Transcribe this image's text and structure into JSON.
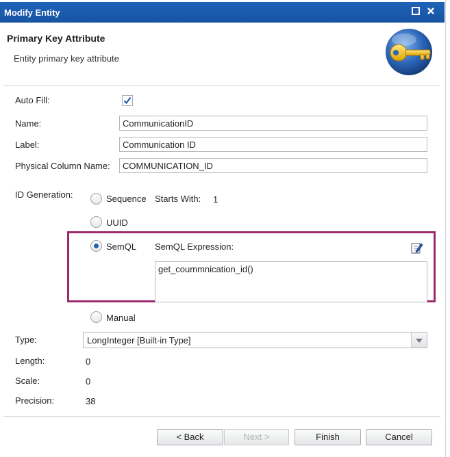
{
  "window": {
    "title": "Modify Entity",
    "maximize_icon": "maximize-icon",
    "close_icon": "close-icon"
  },
  "header": {
    "title": "Primary Key Attribute",
    "subtitle": "Entity primary key attribute",
    "icon": "key-icon"
  },
  "form": {
    "auto_fill": {
      "label": "Auto Fill:",
      "checked": true
    },
    "name": {
      "label": "Name:",
      "value": "CommunicationID"
    },
    "label": {
      "label": "Label:",
      "value": "Communication ID"
    },
    "physical_column": {
      "label": "Physical Column Name:",
      "value": "COMMUNICATION_ID"
    },
    "id_generation": {
      "label": "ID Generation:",
      "selected": "SemQL",
      "options": {
        "sequence": "Sequence",
        "uuid": "UUID",
        "semql": "SemQL",
        "manual": "Manual"
      },
      "starts_with_label": "Starts With:",
      "starts_with_value": "1",
      "semql_expression_label": "SemQL Expression:",
      "semql_expression_value": "get_coummnication_id()"
    },
    "type": {
      "label": "Type:",
      "value": "LongInteger [Built-in Type]"
    },
    "length": {
      "label": "Length:",
      "value": "0"
    },
    "scale": {
      "label": "Scale:",
      "value": "0"
    },
    "precision": {
      "label": "Precision:",
      "value": "38"
    }
  },
  "buttons": {
    "back": "< Back",
    "next": "Next >",
    "finish": "Finish",
    "cancel": "Cancel"
  },
  "colors": {
    "titlebar": "#1753a3",
    "highlight": "#9b2a6c",
    "radio_selected": "#1f5fb0"
  }
}
